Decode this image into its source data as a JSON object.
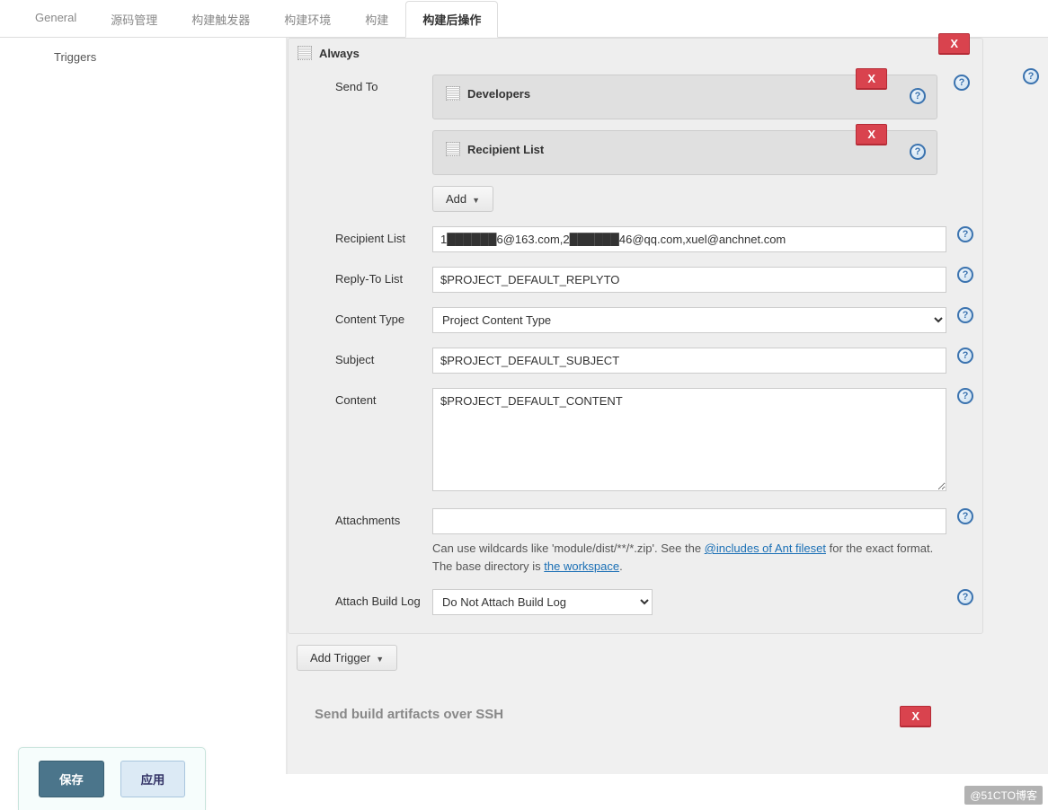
{
  "tabs": {
    "items": [
      "General",
      "源码管理",
      "构建触发器",
      "构建环境",
      "构建",
      "构建后操作"
    ],
    "activeIndex": 5
  },
  "sidebar": {
    "triggers": "Triggers"
  },
  "trigger": {
    "title": "Always",
    "delete_x": "X",
    "sendto": {
      "label": "Send To",
      "items": [
        "Developers",
        "Recipient List"
      ],
      "add_label": "Add"
    },
    "recipient_list": {
      "label": "Recipient List",
      "value": "1██████6@163.com,2██████46@qq.com,xuel@anchnet.com"
    },
    "reply_to": {
      "label": "Reply-To List",
      "value": "$PROJECT_DEFAULT_REPLYTO"
    },
    "content_type": {
      "label": "Content Type",
      "selected": "Project Content Type"
    },
    "subject": {
      "label": "Subject",
      "value": "$PROJECT_DEFAULT_SUBJECT"
    },
    "content": {
      "label": "Content",
      "value": "$PROJECT_DEFAULT_CONTENT"
    },
    "attachments": {
      "label": "Attachments",
      "value": "",
      "help_prefix": "Can use wildcards like 'module/dist/**/*.zip'. See the ",
      "help_link1": "@includes of Ant fileset",
      "help_mid": " for the exact format. The base directory is ",
      "help_link2": "the workspace",
      "help_suffix": "."
    },
    "attach_log": {
      "label": "Attach Build Log",
      "selected": "Do Not Attach Build Log"
    },
    "add_trigger": "Add Trigger"
  },
  "next_section": {
    "title": "Send build artifacts over SSH",
    "delete_x": "X"
  },
  "footer": {
    "save": "保存",
    "apply": "应用"
  },
  "watermark": "@51CTO博客",
  "help_q": "?"
}
